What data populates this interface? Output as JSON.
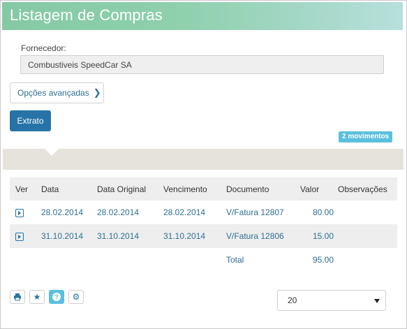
{
  "header": {
    "title": "Listagem de Compras"
  },
  "form": {
    "supplier_label": "Fornecedor:",
    "supplier_value": "Combustiveis SpeedCar SA",
    "advanced_label": "Opções avançadas",
    "extrato_label": "Extrato"
  },
  "badge": {
    "movements": "2 movimentos"
  },
  "table": {
    "columns": [
      "Ver",
      "Data",
      "Data Original",
      "Vencimento",
      "Documento",
      "Valor",
      "Observações"
    ],
    "rows": [
      {
        "data": "28.02.2014",
        "data_original": "28.02.2014",
        "vencimento": "28.02.2014",
        "documento": "V/Fatura 12807",
        "valor": "80.00",
        "observacoes": ""
      },
      {
        "data": "31.10.2014",
        "data_original": "31.10.2014",
        "vencimento": "31.10.2014",
        "documento": "V/Fatura 12806",
        "valor": "15.00",
        "observacoes": ""
      }
    ],
    "total_label": "Total",
    "total_value": "95.00"
  },
  "toolbar": {
    "icons": [
      "print-icon",
      "star-icon",
      "help-icon",
      "gear-icon"
    ]
  },
  "pagination": {
    "page_size": "20"
  },
  "colors": {
    "primary": "#2773a7",
    "info": "#5bc0de",
    "header_start": "#84c9a4",
    "header_end": "#b7e0dc"
  }
}
